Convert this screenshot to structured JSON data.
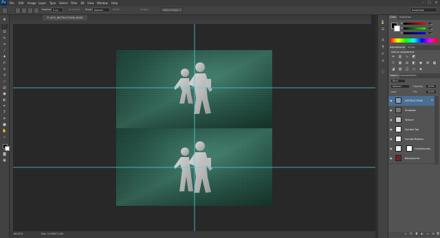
{
  "app": {
    "logo": "Ps",
    "menu": [
      "File",
      "Edit",
      "Image",
      "Layer",
      "Type",
      "Select",
      "Filter",
      "3D",
      "View",
      "Window",
      "Help"
    ],
    "window_controls": [
      "minimize",
      "restore",
      "close"
    ]
  },
  "options_bar": {
    "feather_label": "Feather:",
    "feather_value": "0 px",
    "anti_alias_label": "Anti-alias",
    "style_label": "Style:",
    "style_value": "Normal",
    "width_label": "Width:",
    "height_label": "Height:",
    "refine_edge_label": "Refine Edge...",
    "workspace_value": "Essentials"
  },
  "document": {
    "tab_title": "® ALTS_INSTRUCTIONS_BOOK",
    "status_zoom": "66.67%",
    "status_doc": "Doc: 2.00M/7.14M",
    "canvas_bg": "#1f4a3e",
    "guides_color": "#4fd4e0"
  },
  "color_panel": {
    "tabs": [
      "Color",
      "Swatches"
    ],
    "channels": [
      {
        "label": "R",
        "value": "0"
      },
      {
        "label": "G",
        "value": "0"
      },
      {
        "label": "B",
        "value": "0"
      }
    ]
  },
  "adjustments_panel": {
    "tabs": [
      "Adjustments",
      "Styles"
    ],
    "heading": "Add an adjustment",
    "icons": [
      "brightness-icon",
      "levels-icon",
      "curves-icon",
      "exposure-icon",
      "vibrance-icon",
      "hue-icon",
      "color-balance-icon",
      "bw-icon",
      "photo-filter-icon",
      "channel-mixer-icon",
      "color-lookup-icon",
      "invert-icon",
      "posterize-icon",
      "threshold-icon",
      "gradient-map-icon",
      "selective-color-icon"
    ]
  },
  "layers_panel": {
    "tabs": [
      "Layers",
      "Channels",
      "Paths"
    ],
    "kind_label": "Kind",
    "blend_mode": "Normal",
    "opacity_label": "Opacity:",
    "opacity_value": "100%",
    "lock_label": "Lock:",
    "fill_label": "Fill:",
    "fill_value": "100%",
    "layers": [
      {
        "name": "INSTRUCTIONS",
        "selected": true,
        "thumb": "#8aa0b8"
      },
      {
        "name": "Shadows",
        "selected": false,
        "thumb": "#777777"
      },
      {
        "name": "Texture",
        "selected": false,
        "thumb": "#cccccc"
      },
      {
        "name": "Symbol Top",
        "selected": false,
        "thumb": "#eeeeee"
      },
      {
        "name": "Symbol Bottom",
        "selected": false,
        "thumb": "#eeeeee"
      },
      {
        "name": "Hue/Saturati...",
        "selected": false,
        "thumb": "#eeeeee"
      },
      {
        "name": "Background",
        "selected": false,
        "thumb": "#6a2626"
      }
    ]
  }
}
